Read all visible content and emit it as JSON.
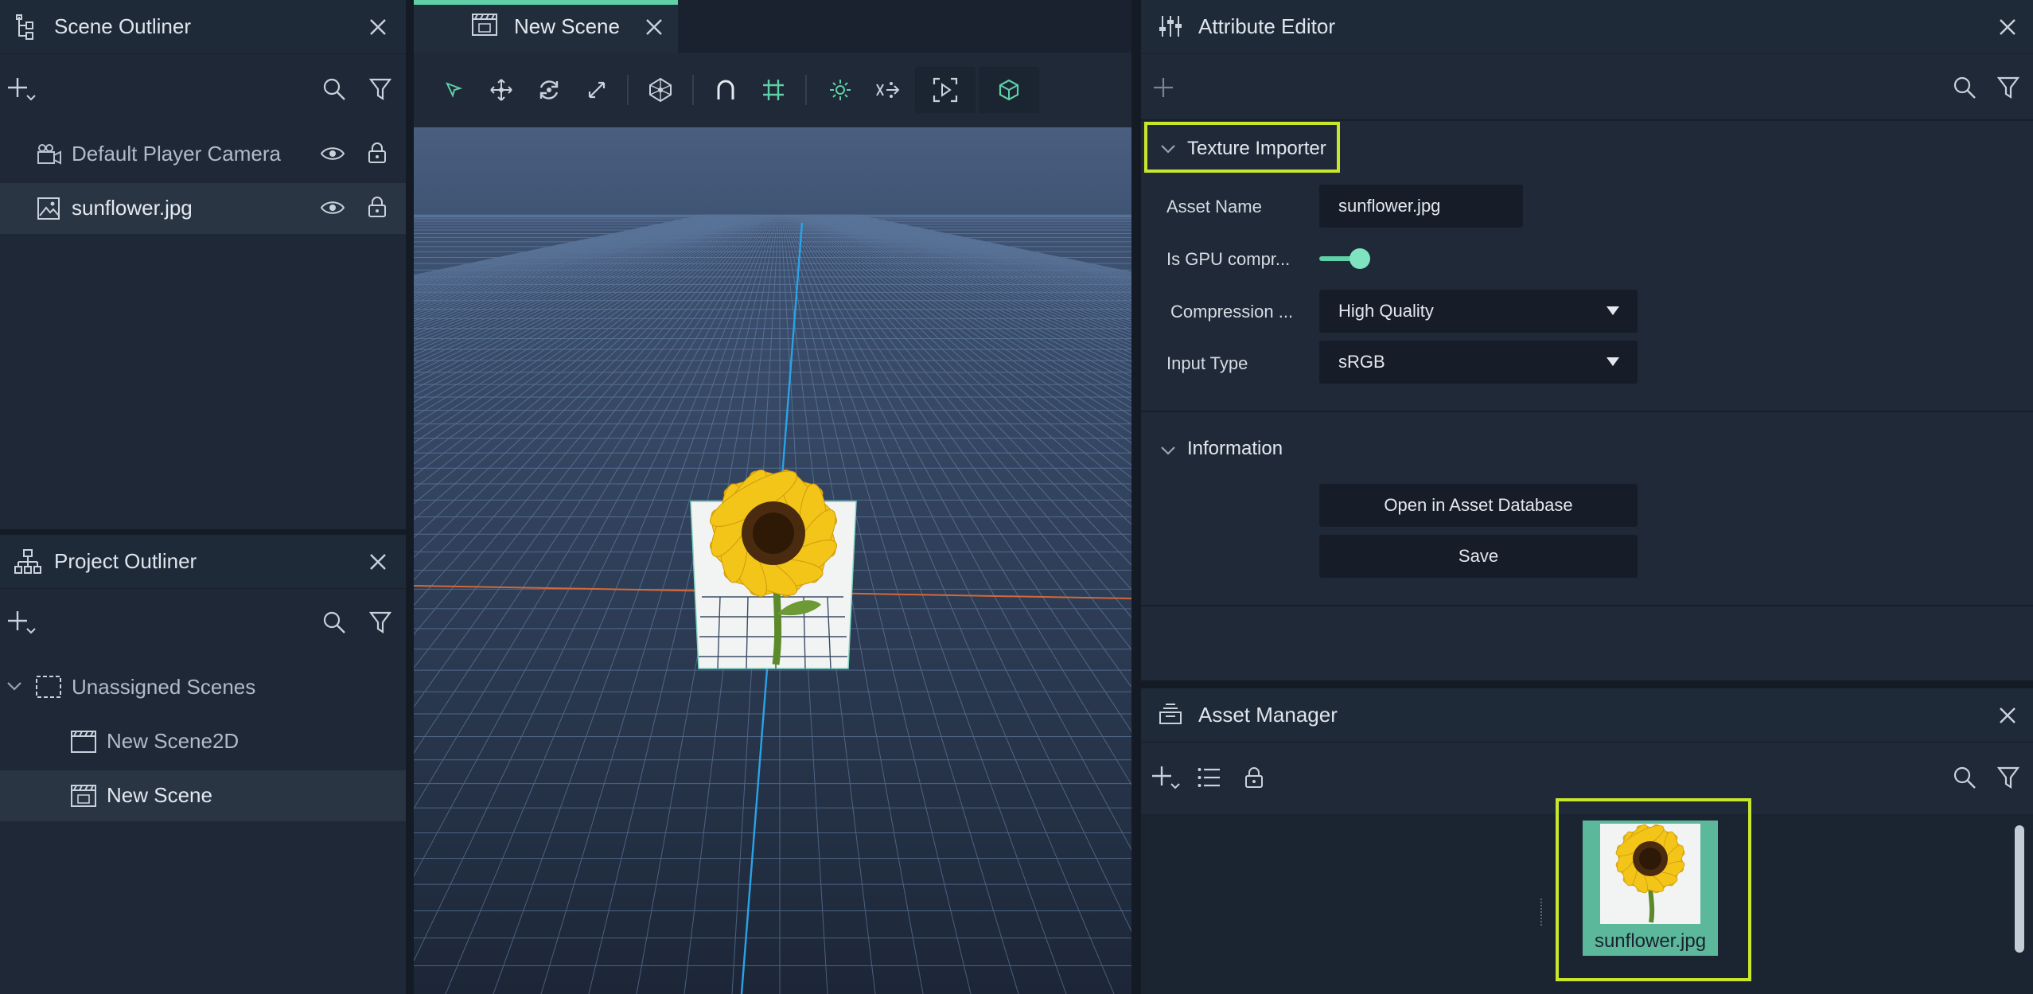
{
  "scene_outliner": {
    "title": "Scene Outliner",
    "items": [
      {
        "label": "Default Player Camera"
      },
      {
        "label": "sunflower.jpg"
      }
    ]
  },
  "project_outliner": {
    "title": "Project Outliner",
    "group": "Unassigned Scenes",
    "items": [
      {
        "label": "New Scene2D"
      },
      {
        "label": "New Scene"
      }
    ]
  },
  "viewport": {
    "tab_label": "New Scene",
    "accent_color": "#5fd0a8"
  },
  "attribute_editor": {
    "title": "Attribute Editor",
    "section_texture": "Texture Importer",
    "asset_name_label": "Asset Name",
    "asset_name_value": "sunflower.jpg",
    "gpu_label": "Is GPU compr...",
    "gpu_enabled": true,
    "compression_label": "Compression ...",
    "compression_value": "High Quality",
    "input_type_label": "Input Type",
    "input_type_value": "sRGB",
    "section_information": "Information",
    "open_button": "Open in Asset Database",
    "save_button": "Save",
    "highlight_color": "#c8e62c"
  },
  "asset_manager": {
    "title": "Asset Manager",
    "asset_label": "sunflower.jpg"
  }
}
